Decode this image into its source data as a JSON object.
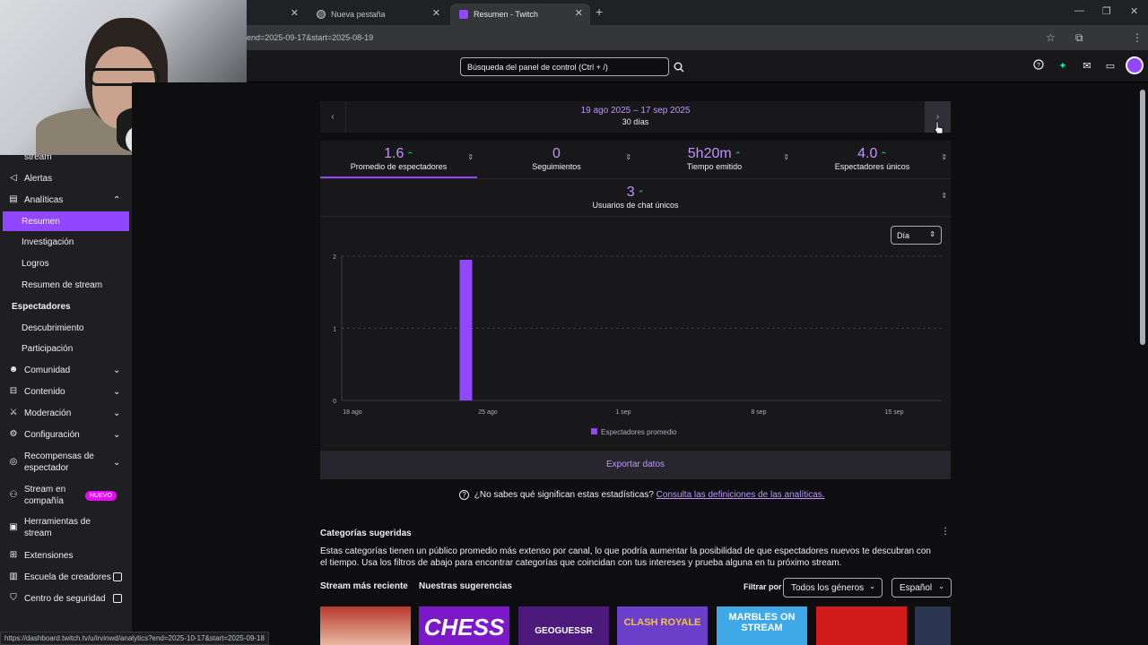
{
  "browser": {
    "tabs": [
      {
        "label": "",
        "active": false
      },
      {
        "label": "Nueva pestaña",
        "active": false
      },
      {
        "label": "Resumen - Twitch",
        "active": true
      }
    ],
    "url": "end=2025-09-17&start=2025-08-19",
    "status_url": "https://dashboard.twitch.tv/u/irvinwd/analytics?end=2025-10-17&start=2025-09-18"
  },
  "topnav": {
    "search_placeholder": "Búsqueda del panel de control (Ctrl + /)"
  },
  "sidebar": {
    "items": [
      {
        "label": "stream"
      },
      {
        "label": "Alertas"
      },
      {
        "label": "Analíticas"
      },
      {
        "label": "Resumen"
      },
      {
        "label": "Investigación"
      },
      {
        "label": "Logros"
      },
      {
        "label": "Resumen de stream"
      },
      {
        "label": "Espectadores"
      },
      {
        "label": "Descubrimiento"
      },
      {
        "label": "Participación"
      },
      {
        "label": "Comunidad"
      },
      {
        "label": "Contenido"
      },
      {
        "label": "Moderación"
      },
      {
        "label": "Configuración"
      },
      {
        "label": "Recompensas de espectador"
      },
      {
        "label": "Stream en compañía"
      },
      {
        "label": "Herramientas de stream"
      },
      {
        "label": "Extensiones"
      },
      {
        "label": "Escuela de creadores"
      },
      {
        "label": "Centro de seguridad"
      }
    ],
    "badge_new": "NUEVO"
  },
  "daterange": {
    "range": "19 ago 2025 – 17 sep 2025",
    "days": "30 días",
    "prev": "‹",
    "next": "›"
  },
  "stats": [
    {
      "value": "1.6",
      "label": "Promedio de espectadores"
    },
    {
      "value": "0",
      "label": "Seguimientos"
    },
    {
      "value": "5h20m",
      "label": "Tiempo emitido"
    },
    {
      "value": "4.0",
      "label": "Espectadores únicos"
    },
    {
      "value": "3",
      "label": "Usuarios de chat únicos"
    }
  ],
  "chart": {
    "granularity": "Día",
    "legend": "Espectadores promedio",
    "export": "Exportar datos"
  },
  "chart_data": {
    "type": "bar",
    "x_start": "18 ago",
    "x_ticks": [
      "18 ago",
      "25 ago",
      "1 sep",
      "8 sep",
      "15 sep"
    ],
    "y_ticks": [
      "0",
      "1",
      "2"
    ],
    "ylim": [
      0,
      2
    ],
    "series": [
      {
        "name": "Espectadores promedio",
        "values": [
          0,
          0,
          0,
          0,
          1.95,
          0,
          0,
          0,
          0,
          0,
          0,
          0,
          0,
          0,
          0,
          0,
          0,
          0,
          0,
          0,
          0,
          0,
          0,
          0,
          0,
          0,
          0,
          0,
          0,
          0,
          0
        ]
      }
    ],
    "color": "#9147ff"
  },
  "help": {
    "question": "¿No sabes qué significan estas estadísticas?",
    "link": "Consulta las definiciones de las analíticas."
  },
  "categories": {
    "title": "Categorías sugeridas",
    "desc": "Estas categorías tienen un público promedio más extenso por canal, lo que podría aumentar la posibilidad de que espectadores nuevos te descubran con el tiempo. Usa los filtros de abajo para encontrar categorías que coincidan con tus intereses y prueba alguna en tu próximo stream.",
    "tab_recent": "Stream más reciente",
    "tab_suggestions": "Nuestras sugerencias",
    "filter_label": "Filtrar por",
    "genre": "Todos los géneros",
    "language": "Español",
    "thumbs": [
      "",
      "CHESS",
      "GEOGUESSR",
      "CLASH ROYALE",
      "MARBLES ON STREAM",
      "",
      ""
    ]
  }
}
